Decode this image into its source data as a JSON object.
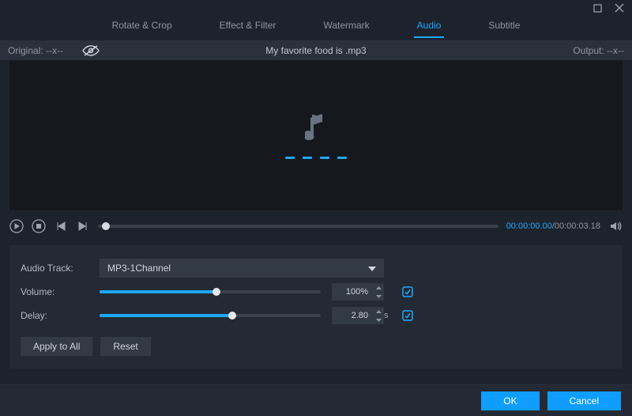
{
  "tabs": {
    "rotate": "Rotate & Crop",
    "effect": "Effect & Filter",
    "watermark": "Watermark",
    "audio": "Audio",
    "subtitle": "Subtitle"
  },
  "infobar": {
    "original_label": "Original: --x--",
    "filename": "My favorite food is .mp3",
    "output_label": "Output: --x--"
  },
  "player": {
    "current_time": "00:00:00.00",
    "total_time": "00:00:03.18"
  },
  "panel": {
    "track_label": "Audio Track:",
    "track_value": "MP3-1Channel",
    "volume_label": "Volume:",
    "volume_value": "100%",
    "volume_fill_pct": 53,
    "delay_label": "Delay:",
    "delay_value": "2.80",
    "delay_unit": "s",
    "delay_fill_pct": 60,
    "apply_all": "Apply to All",
    "reset": "Reset"
  },
  "footer": {
    "ok": "OK",
    "cancel": "Cancel"
  }
}
